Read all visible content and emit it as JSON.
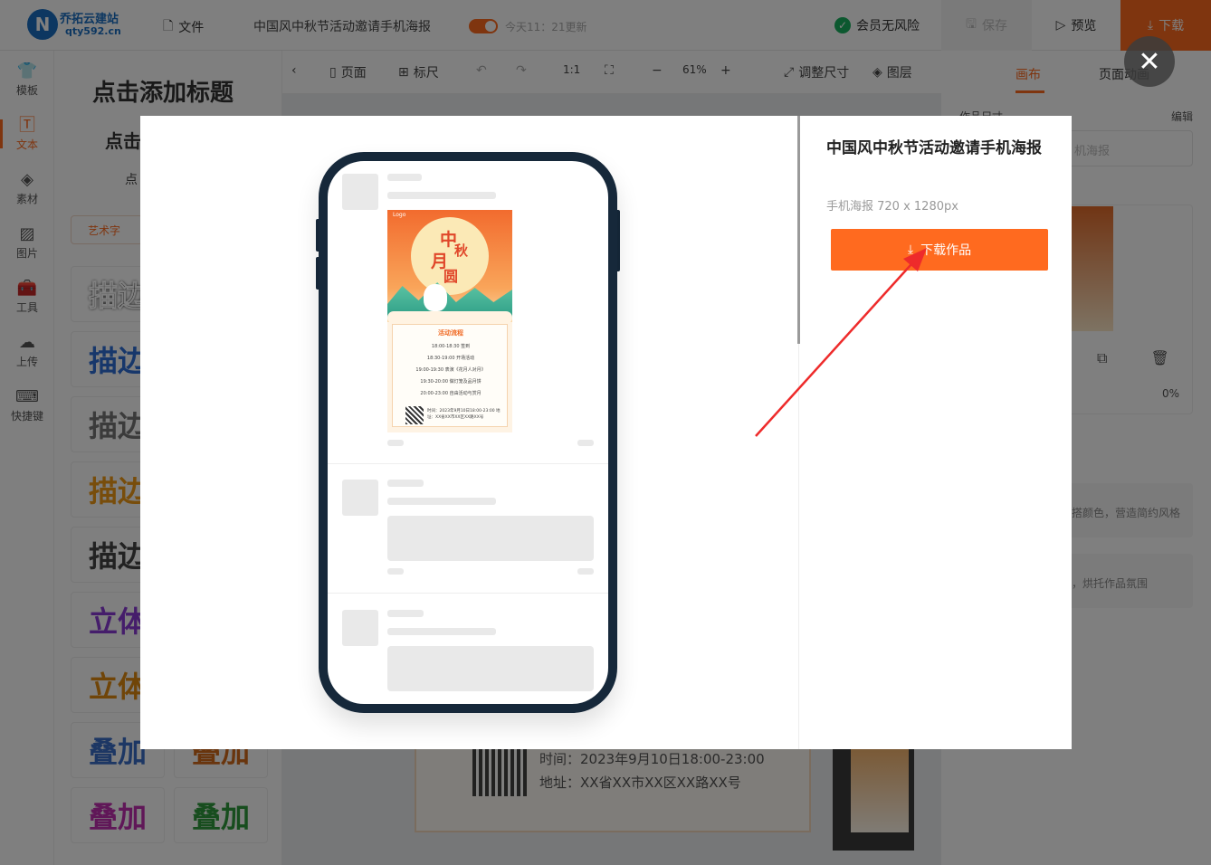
{
  "app": {
    "logo_mark": "N",
    "logo_name": "乔拓云建站",
    "logo_domain": "qty592.cn"
  },
  "topbar": {
    "file_label": "文件",
    "doc_title": "中国风中秋节活动邀请手机海报",
    "update_text": "今天11：21更新",
    "member_text": "会员无风险",
    "save_label": "保存",
    "preview_label": "预览",
    "download_label": "下载"
  },
  "rail": {
    "items": [
      {
        "label": "模板",
        "icon": "tshirt-icon"
      },
      {
        "label": "文本",
        "icon": "text-icon"
      },
      {
        "label": "素材",
        "icon": "shapes-icon"
      },
      {
        "label": "图片",
        "icon": "image-icon"
      },
      {
        "label": "工具",
        "icon": "toolbox-icon"
      },
      {
        "label": "上传",
        "icon": "cloud-upload-icon"
      },
      {
        "label": "快捷键",
        "icon": "keyboard-icon"
      }
    ]
  },
  "text_panel": {
    "heading_1": "点击添加标题",
    "heading_2": "点击",
    "heading_3": "点",
    "tag": "艺术字",
    "art_samples": [
      "描边",
      "描边",
      "描边",
      "描边",
      "描边",
      "立体",
      "立体",
      "叠加",
      "叠加",
      "叠加",
      "叠加"
    ]
  },
  "canvas_toolbar": {
    "page_label": "页面",
    "ruler_label": "标尺",
    "ratio_label": "1:1",
    "zoom": "61%",
    "resize_label": "调整尺寸",
    "layers_label": "图层"
  },
  "canvas": {
    "poster_footer": "时间：2023年9月10日18:00-23:00 地址：XX省XX市XX区XX路XX号"
  },
  "right_panel": {
    "tab_canvas": "画布",
    "tab_animation": "页面动画",
    "size_label": "作品尺寸",
    "edit_label": "编辑",
    "name_value": "机海报",
    "opacity": "0%",
    "card_1_text": "搭颜色，营造简约风格",
    "card_2_text": "，烘托作品氛围"
  },
  "modal": {
    "title": "中国风中秋节活动邀请手机海报",
    "subtitle": "手机海报 720 x 1280px",
    "download_button": "下载作品",
    "close_icon": "close-icon"
  },
  "poster": {
    "logo": "Logo",
    "title_chars": [
      "中",
      "秋",
      "月",
      "圆"
    ],
    "schedule_title": "活动流程",
    "schedule": [
      "18:00-18:30 签到",
      "18:30-19:00 开场活动",
      "19:00-19:30 表演《花月人对月》",
      "19:30-20:00 做灯笼及品月饼",
      "20:00-23:00 自由活动与赏月"
    ],
    "footer": "时间：2023年9月10日18:00-23:00 地址：XX省XX市XX区XX路XX号"
  },
  "colors": {
    "accent": "#ff6a1f",
    "phone_frame": "#16283a",
    "arrow": "#ee2b2b"
  }
}
